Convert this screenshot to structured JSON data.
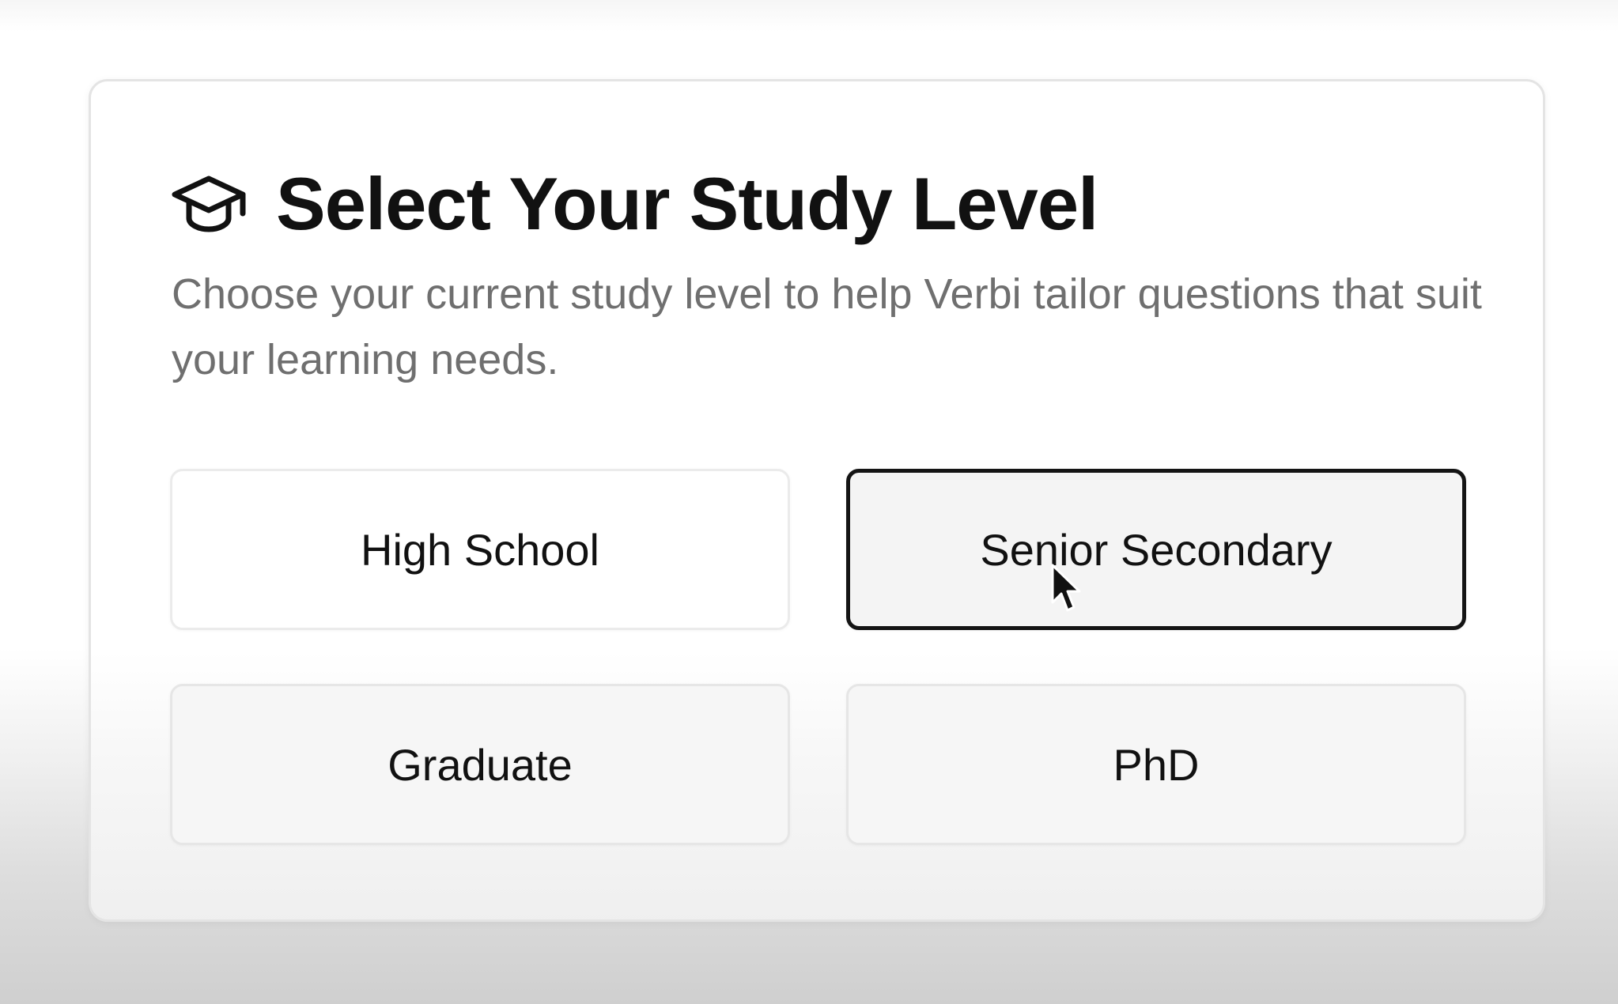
{
  "card": {
    "title": "Select Your Study Level",
    "title_icon": "graduation-cap-icon",
    "subtitle": "Choose your current study level to help Verbi tailor questions that suit your learning needs."
  },
  "options": [
    {
      "label": "High School",
      "selected": false
    },
    {
      "label": "Senior Secondary",
      "selected": true
    },
    {
      "label": "Graduate",
      "selected": false
    },
    {
      "label": "PhD",
      "selected": false
    }
  ],
  "cursor": {
    "icon": "mouse-pointer-icon"
  },
  "colors": {
    "selected_border": "#141414",
    "title_text": "#111111",
    "subtitle_text": "#6f6f6f"
  }
}
